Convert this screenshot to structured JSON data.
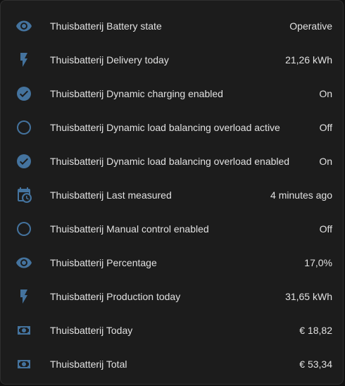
{
  "accent_color": "#44739e",
  "entities": [
    {
      "name": "Thuisbatterij Battery state",
      "state": "Operative",
      "icon": "eye-icon"
    },
    {
      "name": "Thuisbatterij Delivery today",
      "state": "21,26 kWh",
      "icon": "flash-icon"
    },
    {
      "name": "Thuisbatterij Dynamic charging enabled",
      "state": "On",
      "icon": "check-circle-icon"
    },
    {
      "name": "Thuisbatterij Dynamic load balancing overload active",
      "state": "Off",
      "icon": "circle-outline-icon"
    },
    {
      "name": "Thuisbatterij Dynamic load balancing overload enabled",
      "state": "On",
      "icon": "check-circle-icon"
    },
    {
      "name": "Thuisbatterij Last measured",
      "state": "4 minutes ago",
      "icon": "calendar-clock-icon"
    },
    {
      "name": "Thuisbatterij Manual control enabled",
      "state": "Off",
      "icon": "circle-outline-icon"
    },
    {
      "name": "Thuisbatterij Percentage",
      "state": "17,0%",
      "icon": "eye-icon"
    },
    {
      "name": "Thuisbatterij Production today",
      "state": "31,65 kWh",
      "icon": "flash-icon"
    },
    {
      "name": "Thuisbatterij Today",
      "state": "€ 18,82",
      "icon": "cash-icon"
    },
    {
      "name": "Thuisbatterij Total",
      "state": "€ 53,34",
      "icon": "cash-icon"
    }
  ]
}
